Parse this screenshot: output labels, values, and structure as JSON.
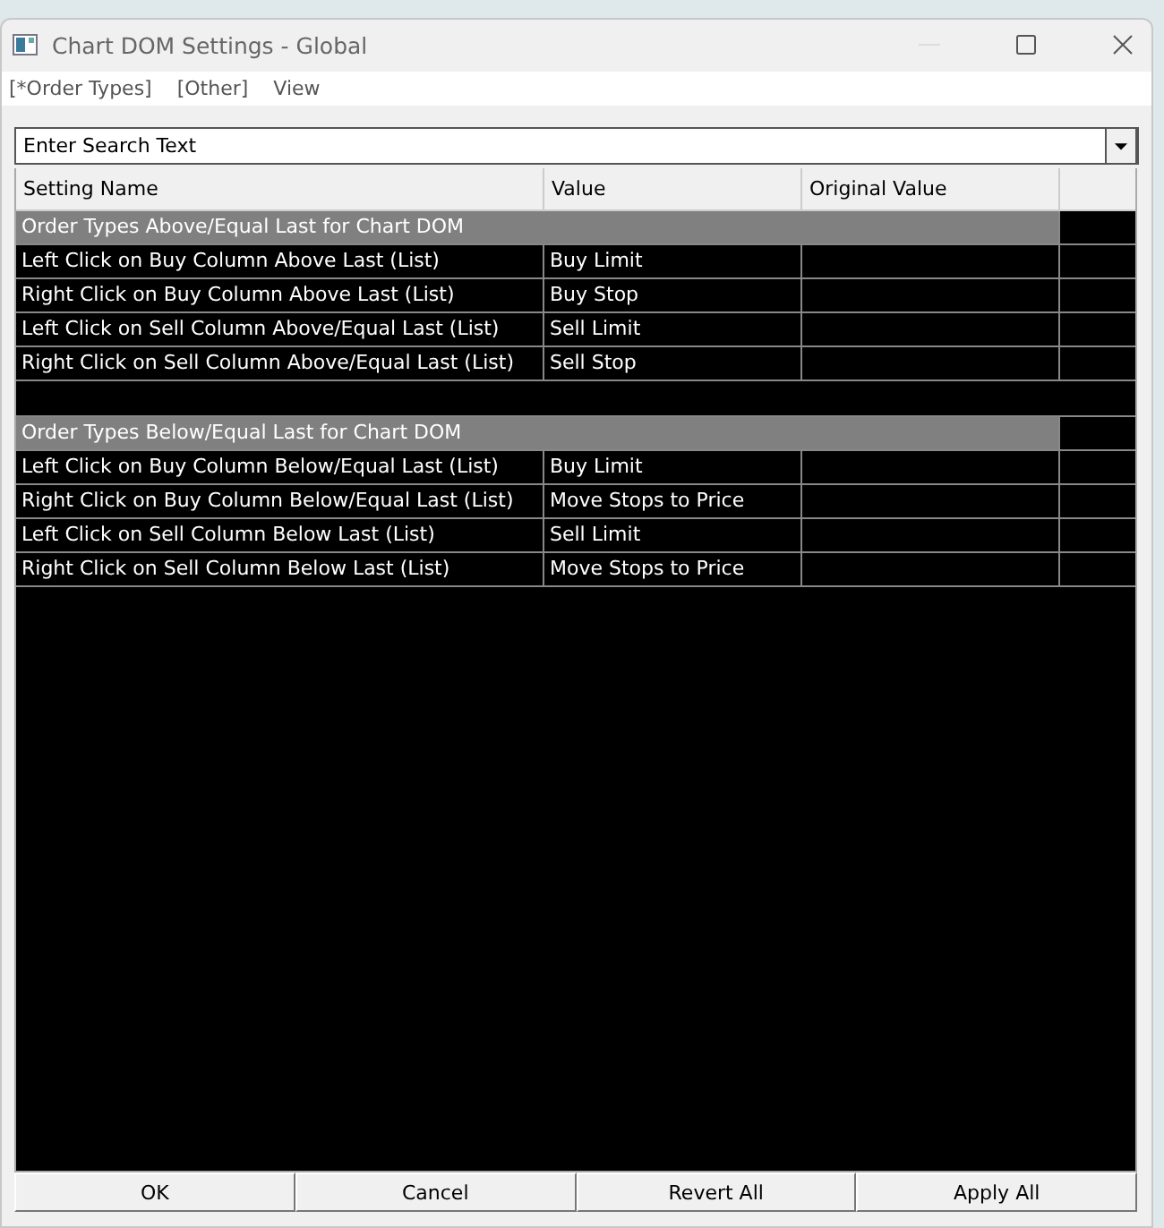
{
  "window": {
    "title": "Chart DOM Settings - Global"
  },
  "menu": [
    "[*Order Types]",
    "[Other]",
    "View"
  ],
  "search": {
    "placeholder": "Enter Search Text"
  },
  "table": {
    "columns": [
      "Setting Name",
      "Value",
      "Original Value"
    ],
    "groups": [
      {
        "title": "Order Types Above/Equal Last for Chart DOM",
        "rows": [
          {
            "name": "Left Click on Buy Column Above Last (List)",
            "value": "Buy Limit"
          },
          {
            "name": "Right Click on Buy Column Above Last (List)",
            "value": "Buy Stop"
          },
          {
            "name": "Left Click on Sell Column Above/Equal Last (List)",
            "value": "Sell Limit"
          },
          {
            "name": "Right Click on Sell Column Above/Equal Last (List)",
            "value": "Sell Stop"
          }
        ]
      },
      {
        "title": "Order Types Below/Equal Last for Chart DOM",
        "rows": [
          {
            "name": "Left Click on Buy Column Below/Equal Last (List)",
            "value": "Buy Limit"
          },
          {
            "name": "Right Click on Buy Column Below/Equal Last (List)",
            "value": "Move Stops to Price"
          },
          {
            "name": "Left Click on Sell Column Below Last (List)",
            "value": "Sell Limit"
          },
          {
            "name": "Right Click on Sell Column Below Last (List)",
            "value": "Move Stops to Price"
          }
        ]
      }
    ]
  },
  "buttons": [
    "OK",
    "Cancel",
    "Revert All",
    "Apply All"
  ]
}
